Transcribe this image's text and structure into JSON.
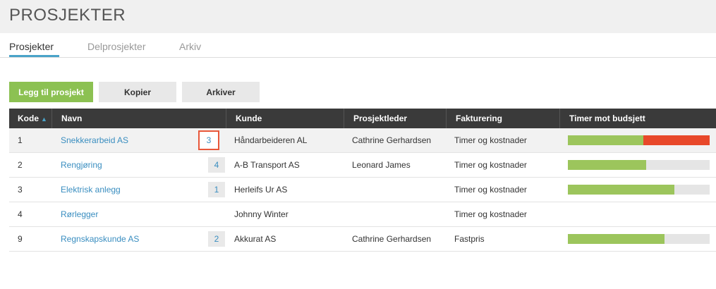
{
  "page": {
    "title": "PROSJEKTER"
  },
  "tabs": [
    {
      "label": "Prosjekter",
      "active": true
    },
    {
      "label": "Delprosjekter",
      "active": false
    },
    {
      "label": "Arkiv",
      "active": false
    }
  ],
  "toolbar": {
    "add_label": "Legg til prosjekt",
    "copy_label": "Kopier",
    "archive_label": "Arkiver"
  },
  "colors": {
    "accent": "#4aa3c8",
    "primary_button": "#8cc152",
    "bar_ok": "#9cc55c",
    "bar_over": "#e8482a",
    "selection": "#e8573a",
    "header_bg": "#3a3a3a"
  },
  "table": {
    "columns": [
      "Kode",
      "Navn",
      "Kunde",
      "Prosjektleder",
      "Fakturering",
      "Timer mot budsjett"
    ],
    "sort_icon": "sort-asc-icon",
    "rows": [
      {
        "kode": "1",
        "navn": "Snekkerarbeid AS",
        "count": "3",
        "kunde": "Håndarbeideren AL",
        "leder": "Cathrine Gerhardsen",
        "fakturering": "Timer og kostnader",
        "budget_used": 0.53,
        "budget_over": 0.47
      },
      {
        "kode": "2",
        "navn": "Rengjøring",
        "count": "4",
        "kunde": "A-B Transport AS",
        "leder": "Leonard James",
        "fakturering": "Timer og kostnader",
        "budget_used": 0.55,
        "budget_over": 0
      },
      {
        "kode": "3",
        "navn": "Elektrisk anlegg",
        "count": "1",
        "kunde": "Herleifs Ur AS",
        "leder": "",
        "fakturering": "Timer og kostnader",
        "budget_used": 0.75,
        "budget_over": 0
      },
      {
        "kode": "4",
        "navn": "Rørlegger",
        "count": "",
        "kunde": "Johnny Winter",
        "leder": "",
        "fakturering": "Timer og kostnader",
        "budget_used": null,
        "budget_over": null
      },
      {
        "kode": "9",
        "navn": "Regnskapskunde AS",
        "count": "2",
        "kunde": "Akkurat AS",
        "leder": "Cathrine Gerhardsen",
        "fakturering": "Fastpris",
        "budget_used": 0.68,
        "budget_over": 0
      }
    ]
  }
}
